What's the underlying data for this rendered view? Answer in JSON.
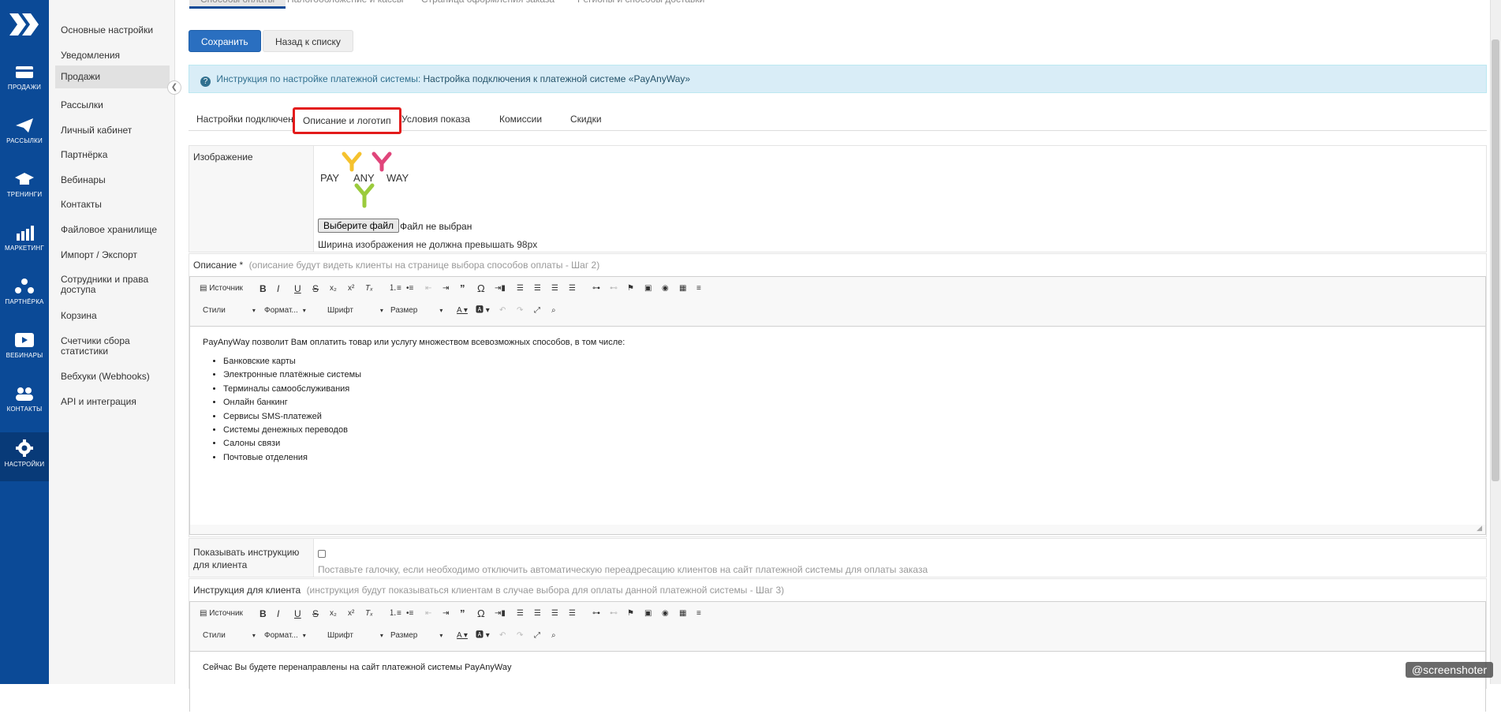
{
  "rail": {
    "items": [
      {
        "label": "ПРОДАЖИ",
        "icon": "sales-icon"
      },
      {
        "label": "РАССЫЛКИ",
        "icon": "paper-plane-icon"
      },
      {
        "label": "ТРЕНИНГИ",
        "icon": "graduation-cap-icon"
      },
      {
        "label": "МАРКЕТИНГ",
        "icon": "chart-bars-icon"
      },
      {
        "label": "ПАРТНЁРКА",
        "icon": "partners-icon"
      },
      {
        "label": "ВЕБИНАРЫ",
        "icon": "play-icon"
      },
      {
        "label": "КОНТАКТЫ",
        "icon": "users-icon"
      },
      {
        "label": "НАСТРОЙКИ",
        "icon": "gear-icon"
      }
    ]
  },
  "sidebar": {
    "items": [
      {
        "label": "Основные настройки"
      },
      {
        "label": "Уведомления"
      },
      {
        "label": "Продажи"
      },
      {
        "label": "Рассылки"
      },
      {
        "label": "Личный кабинет"
      },
      {
        "label": "Партнёрка"
      },
      {
        "label": "Вебинары"
      },
      {
        "label": "Контакты"
      },
      {
        "label": "Файловое хранилище"
      },
      {
        "label": "Импорт / Экспорт"
      },
      {
        "label": "Сотрудники и права доступа"
      },
      {
        "label": "Корзина"
      },
      {
        "label": "Счетчики сбора статистики"
      },
      {
        "label": "Вебхуки (Webhooks)"
      },
      {
        "label": "API и интеграция"
      }
    ]
  },
  "top_tabs": [
    {
      "label": "Способы оплаты"
    },
    {
      "label": "Налогообложение и кассы"
    },
    {
      "label": "Страница оформления заказа"
    },
    {
      "label": "Регионы и способы доставки"
    }
  ],
  "actions": {
    "save": "Сохранить",
    "back": "Назад к списку"
  },
  "info": {
    "prefix": "Инструкция по настройке платежной системы:",
    "link": "Настройка подключения к платежной системе «PayAnyWay»"
  },
  "subtabs": [
    {
      "label": "Настройки подключения"
    },
    {
      "label": "Описание и логотип"
    },
    {
      "label": "Условия показа"
    },
    {
      "label": "Комиссии"
    },
    {
      "label": "Скидки"
    }
  ],
  "image_field": {
    "label": "Изображение",
    "logo_words": [
      "PAY",
      "ANY",
      "WAY"
    ],
    "file_button": "Выберите файл",
    "file_status": "Файл не выбран",
    "width_note": "Ширина изображения не должна превышать 98px"
  },
  "description_field": {
    "label": "Описание *",
    "hint": "(описание будут видеть клиенты на странице выбора способов оплаты - Шаг 2)",
    "intro": "PayAnyWay позволит Вам оплатить товар или услугу множеством всевозможных способов, в том числе:",
    "items": [
      "Банковские карты",
      "Электронные платёжные системы",
      "Терминалы самообслуживания",
      "Онлайн банкинг",
      "Сервисы SMS-платежей",
      "Системы денежных переводов",
      "Салоны связи",
      "Почтовые отделения"
    ]
  },
  "editor_toolbar": {
    "source": "Источник",
    "styles": "Стили",
    "format": "Формат...",
    "font": "Шрифт",
    "size": "Размер"
  },
  "show_instruction": {
    "label": "Показывать инструкцию для клиента",
    "hint": "Поставьте галочку, если необходимо отключить автоматическую переадресацию клиентов на сайт платежной системы для оплаты заказа"
  },
  "instruction_field": {
    "label": "Инструкция для клиента",
    "hint": "(инструкция будут показываться клиентам в случае выбора для оплаты данной платежной системы - Шаг 3)",
    "text": "Сейчас Вы будете перенаправлены на сайт платежной системы PayAnyWay"
  },
  "watermark": "screenshoter",
  "colors": {
    "rail": "#0b4a97",
    "primary": "#2a6fc0",
    "highlight": "#e31b1b",
    "info_bg": "#d9edf7"
  }
}
